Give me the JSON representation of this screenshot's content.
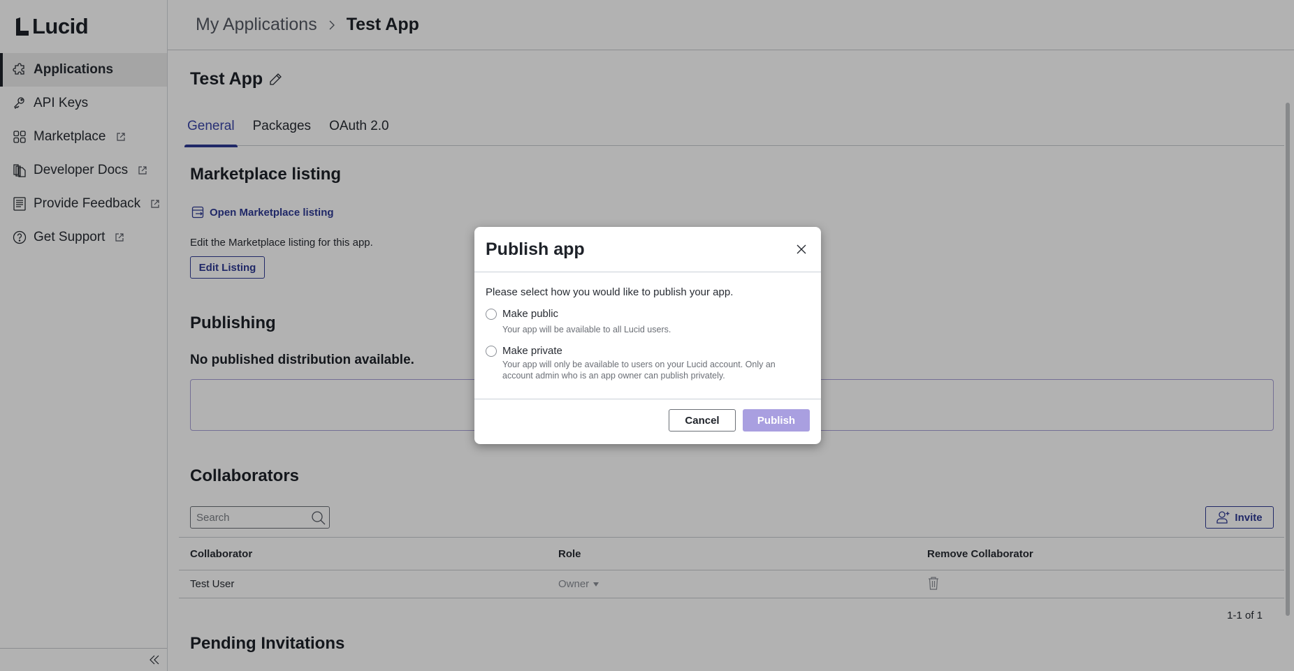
{
  "brand": {
    "name": "Lucid"
  },
  "sidebar": {
    "items": [
      {
        "label": "Applications",
        "icon": "puzzle-icon",
        "active": true,
        "external": false
      },
      {
        "label": "API Keys",
        "icon": "keys-icon",
        "active": false,
        "external": false
      },
      {
        "label": "Marketplace",
        "icon": "grid-icon",
        "active": false,
        "external": true
      },
      {
        "label": "Developer Docs",
        "icon": "docs-icon",
        "active": false,
        "external": true
      },
      {
        "label": "Provide Feedback",
        "icon": "document-icon",
        "active": false,
        "external": true
      },
      {
        "label": "Get Support",
        "icon": "help-circle-icon",
        "active": false,
        "external": true
      }
    ],
    "collapse_icon": "double-chevron-left-icon"
  },
  "breadcrumb": {
    "parent": "My Applications",
    "current": "Test App"
  },
  "page": {
    "title": "Test App",
    "tabs": [
      {
        "label": "General",
        "active": true
      },
      {
        "label": "Packages",
        "active": false
      },
      {
        "label": "OAuth 2.0",
        "active": false
      }
    ]
  },
  "marketplace": {
    "heading": "Marketplace listing",
    "open_link": "Open Marketplace listing",
    "description": "Edit the Marketplace listing for this app.",
    "edit_button": "Edit Listing"
  },
  "publishing": {
    "heading": "Publishing",
    "status": "No published distribution available."
  },
  "collaborators": {
    "heading": "Collaborators",
    "search_placeholder": "Search",
    "search_value": "",
    "invite_button": "Invite",
    "columns": [
      "Collaborator",
      "Role",
      "Remove Collaborator"
    ],
    "rows": [
      {
        "name": "Test User",
        "role": "Owner"
      }
    ],
    "pagination": "1-1 of 1"
  },
  "pending": {
    "heading": "Pending Invitations"
  },
  "modal": {
    "title": "Publish app",
    "prompt": "Please select how you would like to publish your app.",
    "options": [
      {
        "label": "Make public",
        "description": "Your app will be available to all Lucid users.",
        "selected": false
      },
      {
        "label": "Make private",
        "description": "Your app will only be available to users on your Lucid account. Only an account admin who is an app owner can publish privately.",
        "selected": false
      }
    ],
    "cancel_label": "Cancel",
    "publish_label": "Publish",
    "publish_disabled": true
  },
  "colors": {
    "accent": "#2e3a94",
    "publish_disabled": "#a99fe0",
    "overlay": "#b2b2b2"
  }
}
